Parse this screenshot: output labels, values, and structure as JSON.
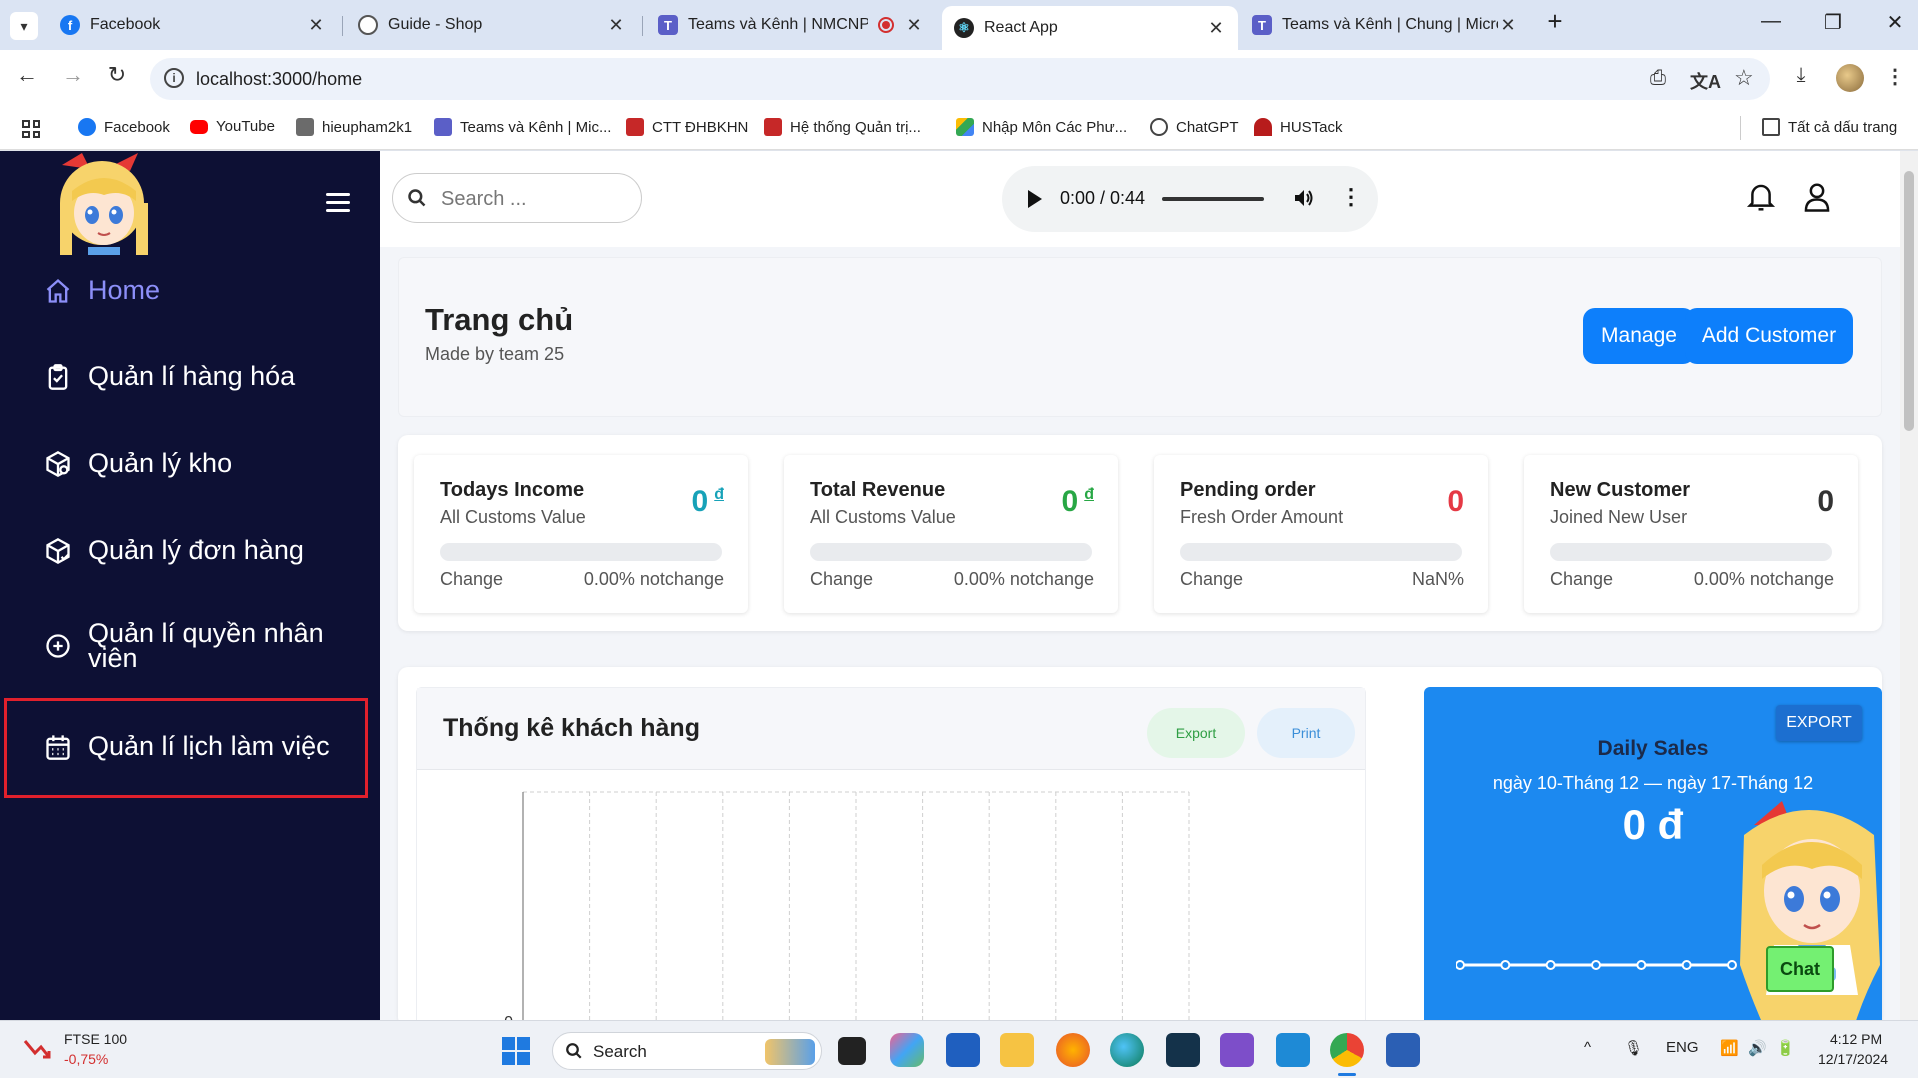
{
  "browser": {
    "tabs": [
      {
        "title": "Facebook",
        "icon": "facebook-icon",
        "color": "#1877f2"
      },
      {
        "title": "Guide - Shop",
        "icon": "globe-icon",
        "color": "#555555"
      },
      {
        "title": "Teams và Kênh | NMCNPM",
        "icon": "teams-icon",
        "color": "#5b5fc7"
      },
      {
        "title": "React App",
        "icon": "react-icon",
        "color": "#222222"
      },
      {
        "title": "Teams và Kênh | Chung | Microsoft",
        "icon": "teams-icon",
        "color": "#5b5fc7"
      }
    ],
    "url": "localhost:3000/home",
    "bookmarks": [
      {
        "label": "Facebook",
        "color": "#1877f2"
      },
      {
        "label": "YouTube",
        "color": "#ff0000"
      },
      {
        "label": "hieupham2k1",
        "color": "#6b6b6b"
      },
      {
        "label": "Teams và Kênh | Mic...",
        "color": "#5b5fc7"
      },
      {
        "label": "CTT ĐHBKHN",
        "color": "#c62828"
      },
      {
        "label": "Hệ thống Quản trị...",
        "color": "#c62828"
      },
      {
        "label": "Nhập Môn Các Phư...",
        "color": "#34a853"
      },
      {
        "label": "ChatGPT",
        "color": "#444444"
      },
      {
        "label": "HUSTack",
        "color": "#b71c1c"
      }
    ],
    "all_bookmarks": "Tất cả dấu trang"
  },
  "sidebar": {
    "items": [
      {
        "label": "Home",
        "icon": "home-icon",
        "active": true
      },
      {
        "label": "Quản lí hàng hóa",
        "icon": "clipboard-check-icon"
      },
      {
        "label": "Quản lý kho",
        "icon": "warehouse-box-icon"
      },
      {
        "label": "Quản lý đơn hàng",
        "icon": "order-box-icon"
      },
      {
        "label": "Quản lí quyền nhân viên",
        "icon": "plus-circle-icon"
      },
      {
        "label": "Quản lí lịch làm việc",
        "icon": "calendar-icon"
      }
    ]
  },
  "topbar": {
    "search_placeholder": "Search ...",
    "audio_time": "0:00 / 0:44"
  },
  "header": {
    "title": "Trang chủ",
    "subtitle": "Made by team 25",
    "manage_label": "Manage",
    "add_customer_label": "Add Customer"
  },
  "stats": [
    {
      "title": "Todays Income",
      "subtitle": "All Customs Value",
      "value": "0",
      "unit": "đ",
      "value_color": "#17a2b8",
      "change_label": "Change",
      "change_value": "0.00% notchange"
    },
    {
      "title": "Total Revenue",
      "subtitle": "All Customs Value",
      "value": "0",
      "unit": "đ",
      "value_color": "#28a745",
      "change_label": "Change",
      "change_value": "0.00% notchange"
    },
    {
      "title": "Pending order",
      "subtitle": "Fresh Order Amount",
      "value": "0",
      "unit": "",
      "value_color": "#e53945",
      "change_label": "Change",
      "change_value": "NaN%"
    },
    {
      "title": "New Customer",
      "subtitle": "Joined New User",
      "value": "0",
      "unit": "",
      "value_color": "#333333",
      "change_label": "Change",
      "change_value": "0.00% notchange"
    }
  ],
  "customer_chart": {
    "title": "Thống kê khách hàng",
    "export_label": "Export",
    "print_label": "Print"
  },
  "chart_data": {
    "type": "line",
    "title": "Thống kê khách hàng",
    "y_tick_labels": [
      "0"
    ],
    "values": [
      0,
      0,
      0,
      0,
      0,
      0,
      0,
      0,
      0,
      0,
      0
    ],
    "grid": true
  },
  "daily_sales": {
    "title": "Daily Sales",
    "range": "ngày 10-Tháng 12 — ngày 17-Tháng 12",
    "value": "0 đ",
    "export_label": "EXPORT",
    "chat_label": "Chat",
    "values": [
      0,
      0,
      0,
      0,
      0,
      0,
      0
    ]
  },
  "taskbar": {
    "ticker_name": "FTSE 100",
    "ticker_change": "-0,75%",
    "search_label": "Search",
    "language": "ENG",
    "time": "4:12 PM",
    "date": "12/17/2024"
  }
}
